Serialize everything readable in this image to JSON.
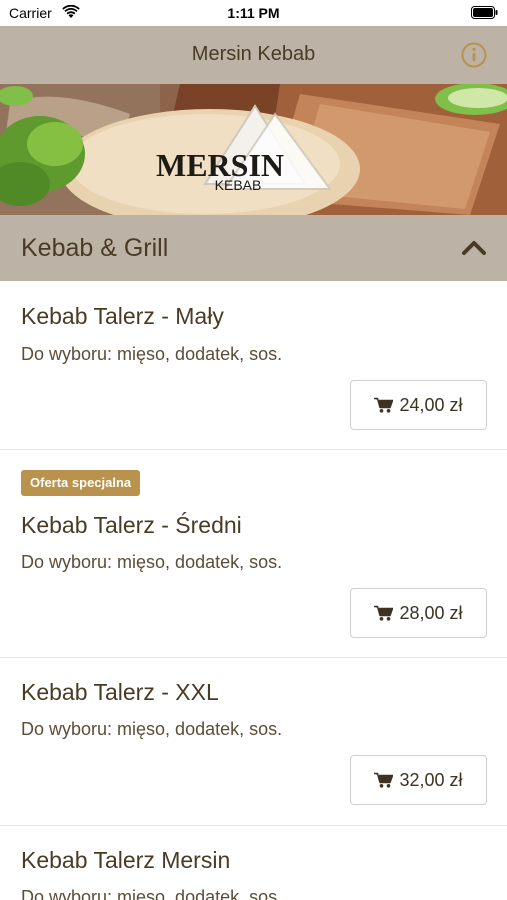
{
  "status_bar": {
    "carrier": "Carrier",
    "time": "1:11 PM"
  },
  "nav": {
    "title": "Mersin Kebab"
  },
  "hero": {
    "logo_main": "MERSIN",
    "logo_sub": "KEBAB"
  },
  "category": {
    "title": "Kebab & Grill"
  },
  "items": [
    {
      "badge": "",
      "name": "Kebab Talerz - Mały",
      "description": "Do wyboru: mięso, dodatek, sos.",
      "price": "24,00 zł"
    },
    {
      "badge": "Oferta specjalna",
      "name": "Kebab Talerz - Średni",
      "description": "Do wyboru: mięso, dodatek, sos.",
      "price": "28,00 zł"
    },
    {
      "badge": "",
      "name": "Kebab Talerz - XXL",
      "description": "Do wyboru: mięso, dodatek, sos.",
      "price": "32,00 zł"
    },
    {
      "badge": "",
      "name": "Kebab Talerz Mersin",
      "description": "Do wyboru: mięso, dodatek, sos.",
      "price": ""
    }
  ],
  "colors": {
    "accent": "#b9924d",
    "bar": "#bcb2a6",
    "text": "#4a3b25"
  }
}
